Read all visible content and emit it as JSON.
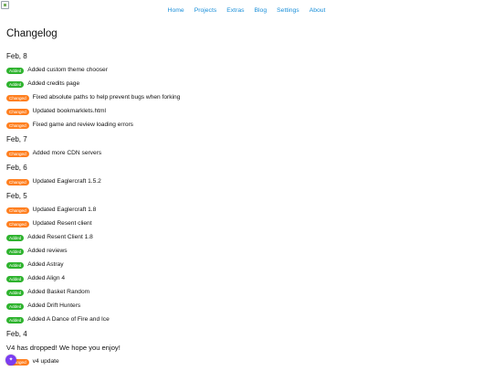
{
  "colors": {
    "link": "#1a8fd9",
    "added": "#2eb32e",
    "changed": "#ff7f1f",
    "fab": "#7b3df0"
  },
  "nav": [
    "Home",
    "Projects",
    "Extras",
    "Blog",
    "Settings",
    "About"
  ],
  "page_title": "Changelog",
  "badge_labels": {
    "added": "Added",
    "changed": "Changed"
  },
  "days": [
    {
      "date": "Feb, 8",
      "entries": [
        {
          "type": "added",
          "text": "Added custom theme chooser"
        },
        {
          "type": "added",
          "text": "Added credits page"
        },
        {
          "type": "changed",
          "text": "Fixed absolute paths to help prevent bugs when forking"
        },
        {
          "type": "changed",
          "text": "Updated bookmarklets.html"
        },
        {
          "type": "changed",
          "text": "Fixed game and review loading errors"
        }
      ]
    },
    {
      "date": "Feb, 7",
      "entries": [
        {
          "type": "changed",
          "text": "Added more CDN servers"
        }
      ]
    },
    {
      "date": "Feb, 6",
      "entries": [
        {
          "type": "changed",
          "text": "Updated Eaglercraft 1.5.2"
        }
      ]
    },
    {
      "date": "Feb, 5",
      "entries": [
        {
          "type": "changed",
          "text": "Updated Eaglercraft 1.8"
        },
        {
          "type": "changed",
          "text": "Updated Resent client"
        },
        {
          "type": "added",
          "text": "Added Resent Client 1.8"
        },
        {
          "type": "added",
          "text": "Added reviews"
        },
        {
          "type": "added",
          "text": "Added Astray"
        },
        {
          "type": "added",
          "text": "Added Align 4"
        },
        {
          "type": "added",
          "text": "Added Basket Random"
        },
        {
          "type": "added",
          "text": "Added Drift Hunters"
        },
        {
          "type": "added",
          "text": "Added A Dance of Fire and Ice"
        }
      ]
    },
    {
      "date": "Feb, 4",
      "announcement": "V4 has dropped! We hope you enjoy!",
      "entries": [
        {
          "type": "changed",
          "text": "v4 update"
        }
      ]
    }
  ],
  "floating_button": {
    "icon": "gear-icon",
    "glyph": "✦"
  }
}
